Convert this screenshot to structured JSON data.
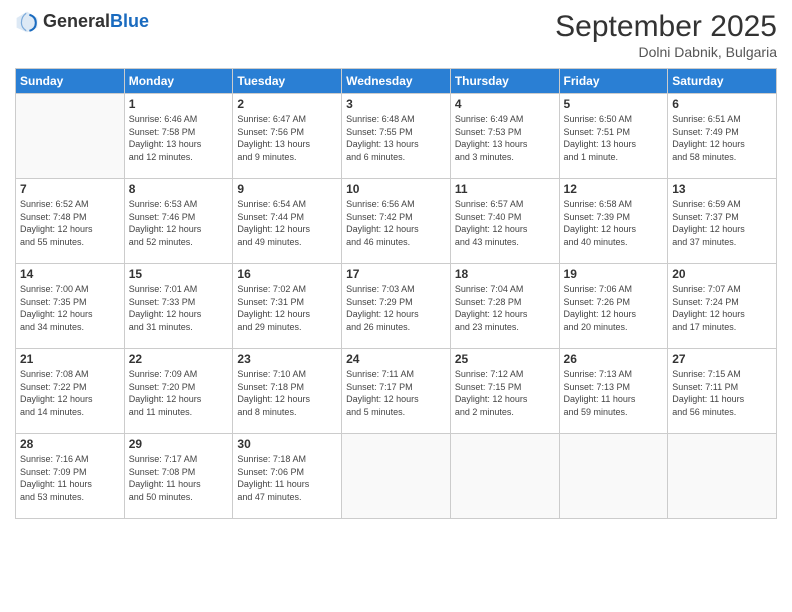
{
  "logo": {
    "general": "General",
    "blue": "Blue"
  },
  "header": {
    "month_year": "September 2025",
    "location": "Dolni Dabnik, Bulgaria"
  },
  "days_of_week": [
    "Sunday",
    "Monday",
    "Tuesday",
    "Wednesday",
    "Thursday",
    "Friday",
    "Saturday"
  ],
  "weeks": [
    [
      {
        "day": "",
        "info": ""
      },
      {
        "day": "1",
        "info": "Sunrise: 6:46 AM\nSunset: 7:58 PM\nDaylight: 13 hours\nand 12 minutes."
      },
      {
        "day": "2",
        "info": "Sunrise: 6:47 AM\nSunset: 7:56 PM\nDaylight: 13 hours\nand 9 minutes."
      },
      {
        "day": "3",
        "info": "Sunrise: 6:48 AM\nSunset: 7:55 PM\nDaylight: 13 hours\nand 6 minutes."
      },
      {
        "day": "4",
        "info": "Sunrise: 6:49 AM\nSunset: 7:53 PM\nDaylight: 13 hours\nand 3 minutes."
      },
      {
        "day": "5",
        "info": "Sunrise: 6:50 AM\nSunset: 7:51 PM\nDaylight: 13 hours\nand 1 minute."
      },
      {
        "day": "6",
        "info": "Sunrise: 6:51 AM\nSunset: 7:49 PM\nDaylight: 12 hours\nand 58 minutes."
      }
    ],
    [
      {
        "day": "7",
        "info": "Sunrise: 6:52 AM\nSunset: 7:48 PM\nDaylight: 12 hours\nand 55 minutes."
      },
      {
        "day": "8",
        "info": "Sunrise: 6:53 AM\nSunset: 7:46 PM\nDaylight: 12 hours\nand 52 minutes."
      },
      {
        "day": "9",
        "info": "Sunrise: 6:54 AM\nSunset: 7:44 PM\nDaylight: 12 hours\nand 49 minutes."
      },
      {
        "day": "10",
        "info": "Sunrise: 6:56 AM\nSunset: 7:42 PM\nDaylight: 12 hours\nand 46 minutes."
      },
      {
        "day": "11",
        "info": "Sunrise: 6:57 AM\nSunset: 7:40 PM\nDaylight: 12 hours\nand 43 minutes."
      },
      {
        "day": "12",
        "info": "Sunrise: 6:58 AM\nSunset: 7:39 PM\nDaylight: 12 hours\nand 40 minutes."
      },
      {
        "day": "13",
        "info": "Sunrise: 6:59 AM\nSunset: 7:37 PM\nDaylight: 12 hours\nand 37 minutes."
      }
    ],
    [
      {
        "day": "14",
        "info": "Sunrise: 7:00 AM\nSunset: 7:35 PM\nDaylight: 12 hours\nand 34 minutes."
      },
      {
        "day": "15",
        "info": "Sunrise: 7:01 AM\nSunset: 7:33 PM\nDaylight: 12 hours\nand 31 minutes."
      },
      {
        "day": "16",
        "info": "Sunrise: 7:02 AM\nSunset: 7:31 PM\nDaylight: 12 hours\nand 29 minutes."
      },
      {
        "day": "17",
        "info": "Sunrise: 7:03 AM\nSunset: 7:29 PM\nDaylight: 12 hours\nand 26 minutes."
      },
      {
        "day": "18",
        "info": "Sunrise: 7:04 AM\nSunset: 7:28 PM\nDaylight: 12 hours\nand 23 minutes."
      },
      {
        "day": "19",
        "info": "Sunrise: 7:06 AM\nSunset: 7:26 PM\nDaylight: 12 hours\nand 20 minutes."
      },
      {
        "day": "20",
        "info": "Sunrise: 7:07 AM\nSunset: 7:24 PM\nDaylight: 12 hours\nand 17 minutes."
      }
    ],
    [
      {
        "day": "21",
        "info": "Sunrise: 7:08 AM\nSunset: 7:22 PM\nDaylight: 12 hours\nand 14 minutes."
      },
      {
        "day": "22",
        "info": "Sunrise: 7:09 AM\nSunset: 7:20 PM\nDaylight: 12 hours\nand 11 minutes."
      },
      {
        "day": "23",
        "info": "Sunrise: 7:10 AM\nSunset: 7:18 PM\nDaylight: 12 hours\nand 8 minutes."
      },
      {
        "day": "24",
        "info": "Sunrise: 7:11 AM\nSunset: 7:17 PM\nDaylight: 12 hours\nand 5 minutes."
      },
      {
        "day": "25",
        "info": "Sunrise: 7:12 AM\nSunset: 7:15 PM\nDaylight: 12 hours\nand 2 minutes."
      },
      {
        "day": "26",
        "info": "Sunrise: 7:13 AM\nSunset: 7:13 PM\nDaylight: 11 hours\nand 59 minutes."
      },
      {
        "day": "27",
        "info": "Sunrise: 7:15 AM\nSunset: 7:11 PM\nDaylight: 11 hours\nand 56 minutes."
      }
    ],
    [
      {
        "day": "28",
        "info": "Sunrise: 7:16 AM\nSunset: 7:09 PM\nDaylight: 11 hours\nand 53 minutes."
      },
      {
        "day": "29",
        "info": "Sunrise: 7:17 AM\nSunset: 7:08 PM\nDaylight: 11 hours\nand 50 minutes."
      },
      {
        "day": "30",
        "info": "Sunrise: 7:18 AM\nSunset: 7:06 PM\nDaylight: 11 hours\nand 47 minutes."
      },
      {
        "day": "",
        "info": ""
      },
      {
        "day": "",
        "info": ""
      },
      {
        "day": "",
        "info": ""
      },
      {
        "day": "",
        "info": ""
      }
    ]
  ]
}
